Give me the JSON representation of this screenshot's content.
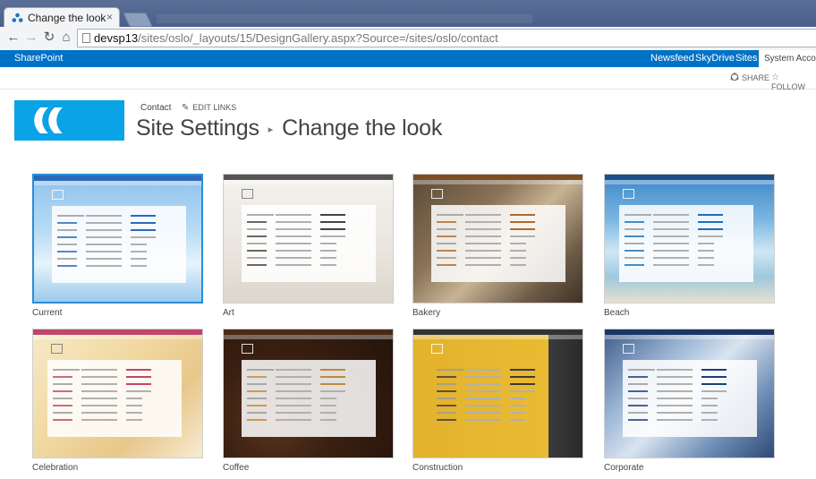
{
  "browser": {
    "tab_title": "Change the look",
    "tab_close": "×",
    "url_host": "devsp13",
    "url_path": "/sites/oslo/_layouts/15/DesignGallery.aspx?Source=/sites/oslo/contact",
    "back": "←",
    "forward": "→",
    "reload": "↻",
    "home": "⌂"
  },
  "suitebar": {
    "brand": "SharePoint",
    "links": [
      "Newsfeed",
      "SkyDrive",
      "Sites"
    ],
    "user": "System Account"
  },
  "actionbar": {
    "share": "SHARE",
    "follow": "FOLLOW",
    "share_icon": "share-icon",
    "follow_icon": "star-icon"
  },
  "header": {
    "breadcrumb_link": "Contact",
    "edit_links": "EDIT LINKS",
    "title_parent": "Site Settings",
    "title_separator": "▸",
    "title_current": "Change the look"
  },
  "gallery": [
    {
      "name": "Current",
      "selected": true,
      "bg": "sky",
      "accent": "#2a6ab8"
    },
    {
      "name": "Art",
      "selected": false,
      "bg": "art",
      "accent": "#444444"
    },
    {
      "name": "Bakery",
      "selected": false,
      "bg": "bakery",
      "accent": "#b06a2a"
    },
    {
      "name": "Beach",
      "selected": false,
      "bg": "beach",
      "accent": "#1d6fb8"
    },
    {
      "name": "Celebration",
      "selected": false,
      "bg": "celebration",
      "accent": "#c0466b"
    },
    {
      "name": "Coffee",
      "selected": false,
      "bg": "coffee",
      "accent": "#c08a3a"
    },
    {
      "name": "Construction",
      "selected": false,
      "bg": "construction",
      "accent": "#3a3a3a"
    },
    {
      "name": "Corporate",
      "selected": false,
      "bg": "corporate",
      "accent": "#1c3f7a"
    }
  ]
}
